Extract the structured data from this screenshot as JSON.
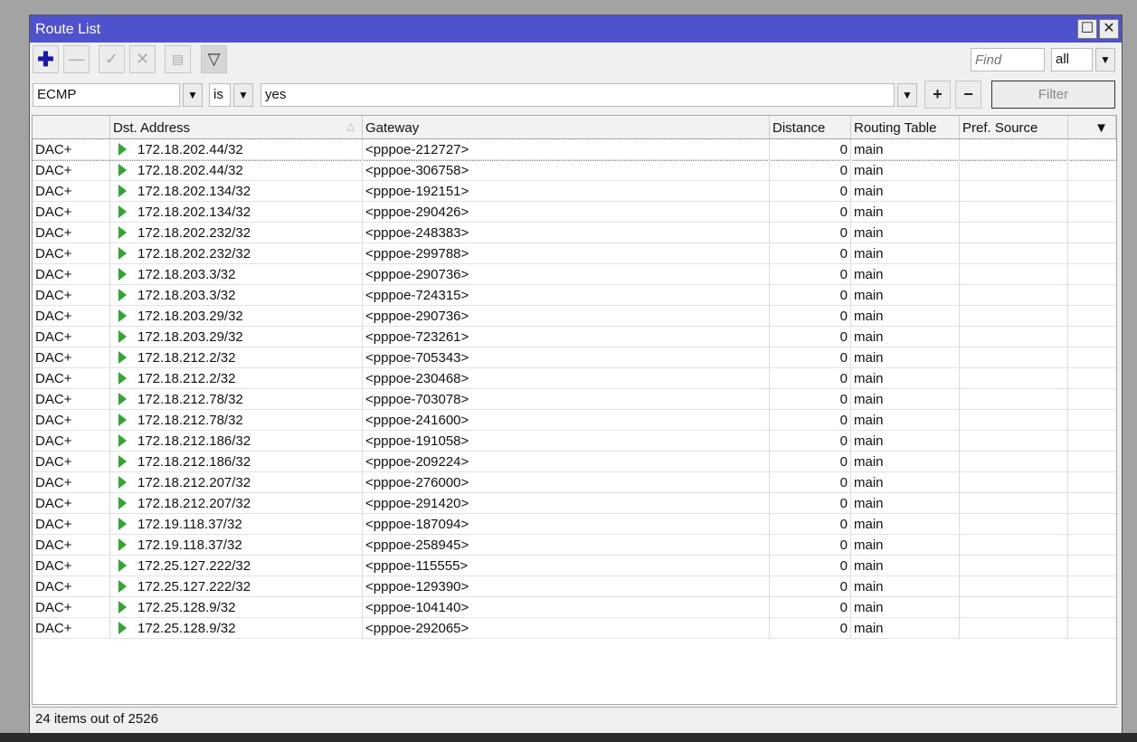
{
  "window": {
    "title": "Route List"
  },
  "toolbar": {
    "find_placeholder": "Find",
    "scope": "all"
  },
  "filter": {
    "field": "ECMP",
    "operator": "is",
    "value": "yes",
    "apply_label": "Filter"
  },
  "columns": [
    "",
    "Dst. Address",
    "Gateway",
    "Distance",
    "Routing Table",
    "Pref. Source"
  ],
  "rows": [
    [
      "DAC+",
      "172.18.202.44/32",
      "<pppoe-212727>",
      "0",
      "main"
    ],
    [
      "DAC+",
      "172.18.202.44/32",
      "<pppoe-306758>",
      "0",
      "main"
    ],
    [
      "DAC+",
      "172.18.202.134/32",
      "<pppoe-192151>",
      "0",
      "main"
    ],
    [
      "DAC+",
      "172.18.202.134/32",
      "<pppoe-290426>",
      "0",
      "main"
    ],
    [
      "DAC+",
      "172.18.202.232/32",
      "<pppoe-248383>",
      "0",
      "main"
    ],
    [
      "DAC+",
      "172.18.202.232/32",
      "<pppoe-299788>",
      "0",
      "main"
    ],
    [
      "DAC+",
      "172.18.203.3/32",
      "<pppoe-290736>",
      "0",
      "main"
    ],
    [
      "DAC+",
      "172.18.203.3/32",
      "<pppoe-724315>",
      "0",
      "main"
    ],
    [
      "DAC+",
      "172.18.203.29/32",
      "<pppoe-290736>",
      "0",
      "main"
    ],
    [
      "DAC+",
      "172.18.203.29/32",
      "<pppoe-723261>",
      "0",
      "main"
    ],
    [
      "DAC+",
      "172.18.212.2/32",
      "<pppoe-705343>",
      "0",
      "main"
    ],
    [
      "DAC+",
      "172.18.212.2/32",
      "<pppoe-230468>",
      "0",
      "main"
    ],
    [
      "DAC+",
      "172.18.212.78/32",
      "<pppoe-703078>",
      "0",
      "main"
    ],
    [
      "DAC+",
      "172.18.212.78/32",
      "<pppoe-241600>",
      "0",
      "main"
    ],
    [
      "DAC+",
      "172.18.212.186/32",
      "<pppoe-191058>",
      "0",
      "main"
    ],
    [
      "DAC+",
      "172.18.212.186/32",
      "<pppoe-209224>",
      "0",
      "main"
    ],
    [
      "DAC+",
      "172.18.212.207/32",
      "<pppoe-276000>",
      "0",
      "main"
    ],
    [
      "DAC+",
      "172.18.212.207/32",
      "<pppoe-291420>",
      "0",
      "main"
    ],
    [
      "DAC+",
      "172.19.118.37/32",
      "<pppoe-187094>",
      "0",
      "main"
    ],
    [
      "DAC+",
      "172.19.118.37/32",
      "<pppoe-258945>",
      "0",
      "main"
    ],
    [
      "DAC+",
      "172.25.127.222/32",
      "<pppoe-115555>",
      "0",
      "main"
    ],
    [
      "DAC+",
      "172.25.127.222/32",
      "<pppoe-129390>",
      "0",
      "main"
    ],
    [
      "DAC+",
      "172.25.128.9/32",
      "<pppoe-104140>",
      "0",
      "main"
    ],
    [
      "DAC+",
      "172.25.128.9/32",
      "<pppoe-292065>",
      "0",
      "main"
    ]
  ],
  "status": "24 items out of 2526"
}
